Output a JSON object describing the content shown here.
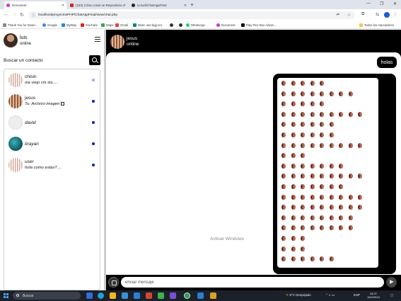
{
  "browser": {
    "tabs": [
      {
        "label": "Document",
        "active": true
      },
      {
        "label": "(243) Cómo crear un Repositorio...",
        "active": false
      },
      {
        "label": "lu-luzk/ChatAppFinal",
        "active": false
      }
    ],
    "url": "localhost/proyectosPHP/ChatAppFinal/view/chat.php",
    "bookmarks": [
      "Thank You for Down...",
      "Google",
      "MyWay",
      "YouTube",
      "Maps",
      "Gmail",
      "Meet: wvr-kpjj-vcs",
      "WhatsApp",
      "Document",
      "Play Flex Box Adven..."
    ],
    "all_bookmarks": "Todos los marcadores"
  },
  "user": {
    "name": "luis",
    "status": "online"
  },
  "search": {
    "placeholder": "Buscar un contacto"
  },
  "contacts": [
    {
      "name": "chisin",
      "last_message": "ola viejo cm sts....",
      "italic": false,
      "unread": "light"
    },
    {
      "name": "jesus",
      "last_message": "Tu: Archivo imagen",
      "italic": false,
      "unread": "dark"
    },
    {
      "name": "david",
      "last_message": "",
      "italic": true,
      "unread": "dark"
    },
    {
      "name": "brayan",
      "last_message": "",
      "italic": true,
      "unread": "dark"
    },
    {
      "name": "user",
      "last_message": "hola como estas?....",
      "italic": true,
      "unread": "dark"
    }
  ],
  "chat": {
    "contact_name": "jesus",
    "contact_status": "online",
    "messages": [
      {
        "type": "text",
        "text": "holas",
        "sender": "me"
      },
      {
        "type": "image",
        "sender": "me"
      }
    ],
    "watermark": "Activar Windows",
    "input_placeholder": "enviar mensaje"
  },
  "taskbar": {
    "search_label": "Buscar",
    "weather": "9°C  Despejado",
    "language": "ESP",
    "time": "18:27",
    "date": "16/4/2024"
  }
}
